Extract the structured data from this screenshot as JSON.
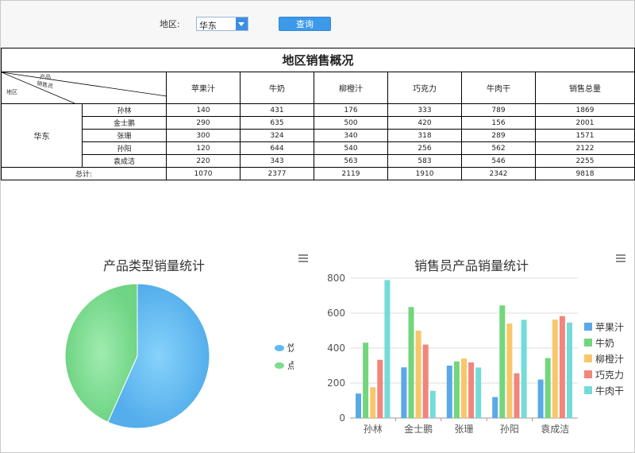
{
  "filter": {
    "region_label": "地区:",
    "region_value": "华东",
    "query_label": "查询"
  },
  "report": {
    "title": "地区销售概况",
    "corner": {
      "product": "产品",
      "salesperson": "销售员",
      "region": "地区"
    },
    "columns": [
      "苹果汁",
      "牛奶",
      "柳橙汁",
      "巧克力",
      "牛肉干",
      "销售总量"
    ],
    "region": "华东",
    "rows": [
      {
        "name": "孙林",
        "values": [
          "140",
          "431",
          "176",
          "333",
          "789",
          "1869"
        ]
      },
      {
        "name": "金士鹏",
        "values": [
          "290",
          "635",
          "500",
          "420",
          "156",
          "2001"
        ]
      },
      {
        "name": "张珊",
        "values": [
          "300",
          "324",
          "340",
          "318",
          "289",
          "1571"
        ]
      },
      {
        "name": "孙阳",
        "values": [
          "120",
          "644",
          "540",
          "256",
          "562",
          "2122"
        ]
      },
      {
        "name": "袁成洁",
        "values": [
          "220",
          "343",
          "563",
          "583",
          "546",
          "2255"
        ]
      }
    ],
    "total_label": "总计:",
    "totals": [
      "1070",
      "2377",
      "2119",
      "1910",
      "2342",
      "9818"
    ]
  },
  "chart_data": [
    {
      "type": "pie",
      "title": "产品类型销量统计",
      "categories": [
        "饮料",
        "点心"
      ],
      "values": [
        5566,
        4252
      ],
      "colors": [
        "#62b8f0",
        "#7ddc8f"
      ],
      "legend_position": "right"
    },
    {
      "type": "bar",
      "title": "销售员产品销量统计",
      "categories": [
        "孙林",
        "金士鹏",
        "张珊",
        "孙阳",
        "袁成洁"
      ],
      "series": [
        {
          "name": "苹果汁",
          "color": "#5aa8e8",
          "values": [
            140,
            290,
            300,
            120,
            220
          ]
        },
        {
          "name": "牛奶",
          "color": "#72d67d",
          "values": [
            431,
            635,
            324,
            644,
            343
          ]
        },
        {
          "name": "柳橙汁",
          "color": "#f8c76b",
          "values": [
            176,
            500,
            340,
            540,
            563
          ]
        },
        {
          "name": "巧克力",
          "color": "#f2857c",
          "values": [
            333,
            420,
            318,
            256,
            583
          ]
        },
        {
          "name": "牛肉干",
          "color": "#74dcd8",
          "values": [
            789,
            156,
            289,
            562,
            546
          ]
        }
      ],
      "yticks": [
        "0",
        "200",
        "400",
        "600",
        "800"
      ],
      "ylim": [
        0,
        800
      ],
      "grid": true,
      "legend_position": "right"
    }
  ]
}
